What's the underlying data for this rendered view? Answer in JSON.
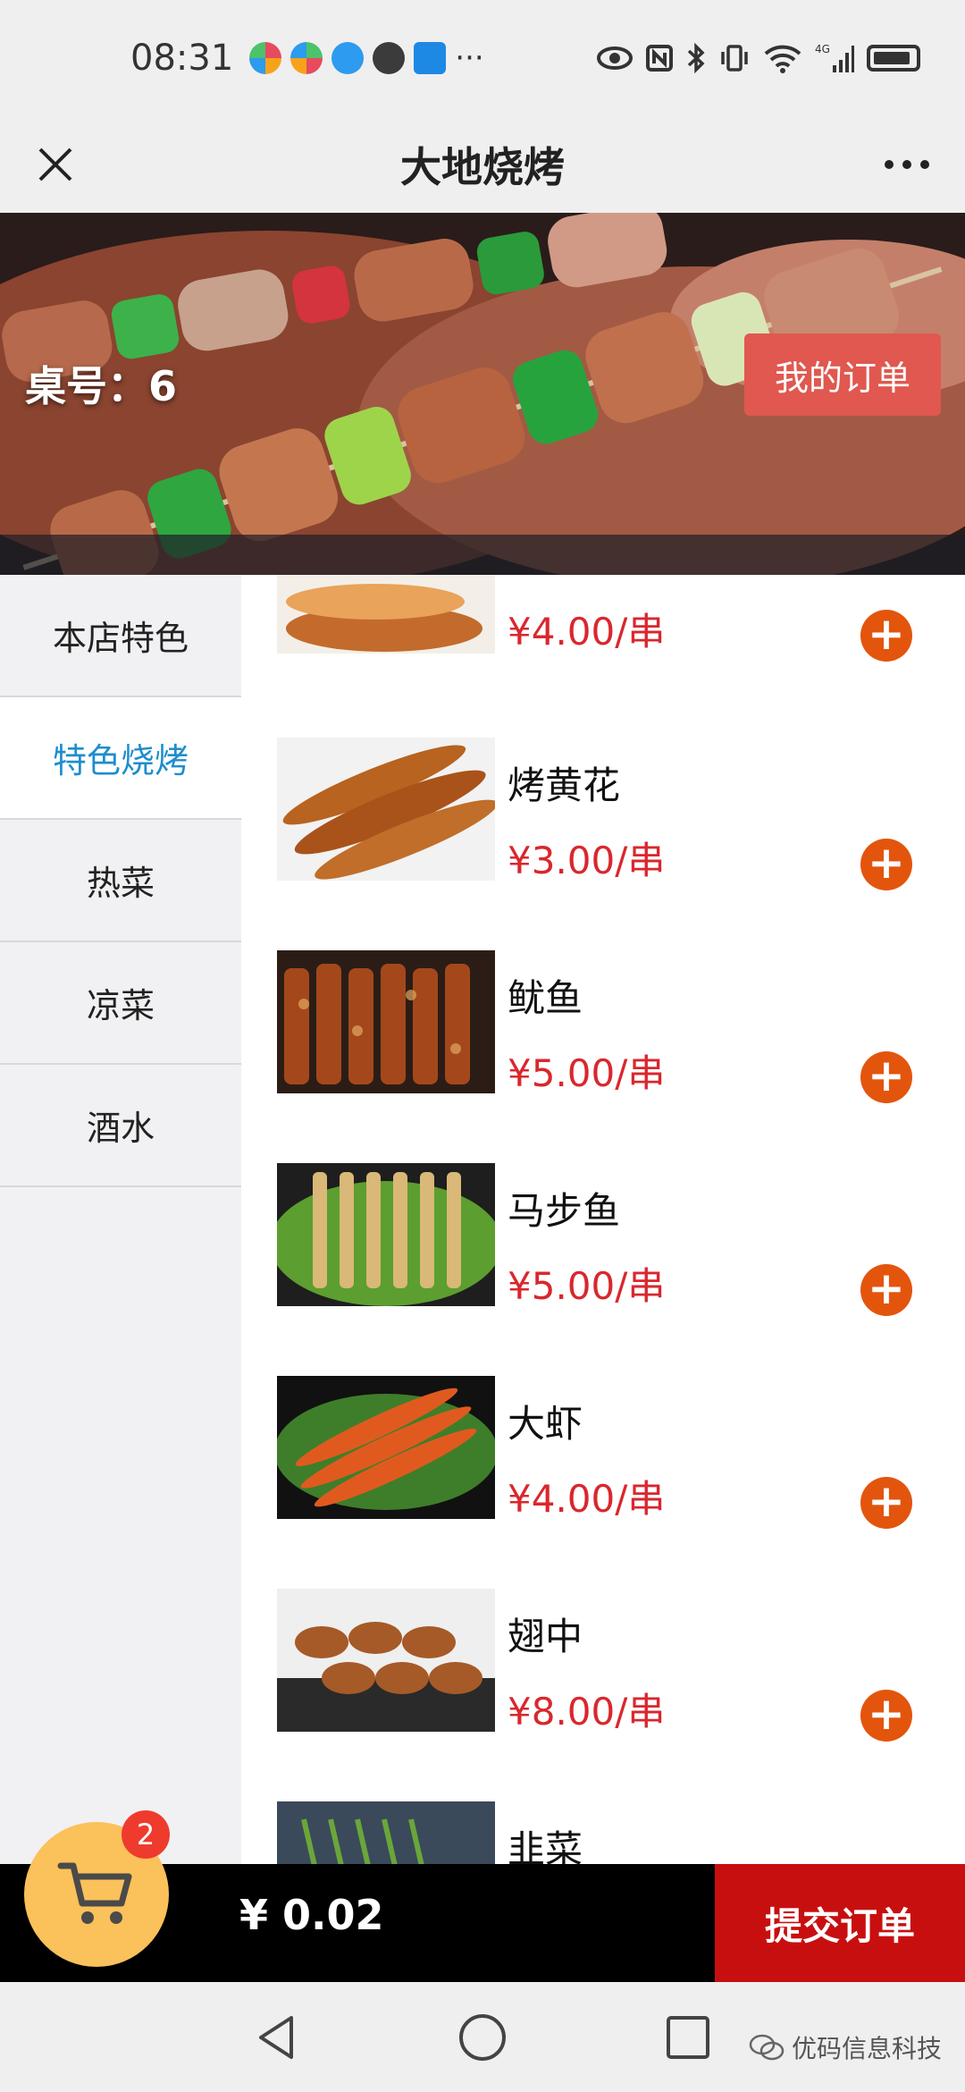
{
  "status_bar": {
    "time": "08:31",
    "network": "4G",
    "app_icon_colors": [
      "#e84a5f",
      "#f6a31b",
      "#2c9bf0",
      "#3b3b3b",
      "#1e88e5"
    ],
    "more": "···"
  },
  "title_bar": {
    "title": "大地烧烤",
    "close_icon": "close-icon",
    "more_icon": "more-icon"
  },
  "banner": {
    "table_label": "桌号：",
    "table_number": "6",
    "my_orders_label": "我的订单"
  },
  "categories": [
    {
      "label": "本店特色",
      "active": false
    },
    {
      "label": "特色烧烤",
      "active": true
    },
    {
      "label": "热菜",
      "active": false
    },
    {
      "label": "凉菜",
      "active": false
    },
    {
      "label": "酒水",
      "active": false
    }
  ],
  "products": [
    {
      "name": "",
      "price": "¥4.00/串",
      "thumb_colors": [
        "#c36b2c",
        "#e9a35a"
      ]
    },
    {
      "name": "烤黄花",
      "price": "¥3.00/串",
      "thumb_colors": [
        "#b8631f",
        "#f2f2f2"
      ]
    },
    {
      "name": "鱿鱼",
      "price": "¥5.00/串",
      "thumb_colors": [
        "#a4481c",
        "#e0a85f"
      ]
    },
    {
      "name": "马步鱼",
      "price": "¥5.00/串",
      "thumb_colors": [
        "#5c9e2f",
        "#d9b878"
      ]
    },
    {
      "name": "大虾",
      "price": "¥4.00/串",
      "thumb_colors": [
        "#e05a1f",
        "#3e7e2a"
      ]
    },
    {
      "name": "翅中",
      "price": "¥8.00/串",
      "thumb_colors": [
        "#a65a28",
        "#efefef"
      ]
    },
    {
      "name": "韭菜",
      "price": "",
      "thumb_colors": [
        "#6aa63a",
        "#3a4a5a"
      ]
    }
  ],
  "cart": {
    "badge_count": "2",
    "total": "¥ 0.02",
    "submit_label": "提交订单",
    "accent": "#c80f0f"
  },
  "nav": {
    "watermark": "优码信息科技"
  }
}
